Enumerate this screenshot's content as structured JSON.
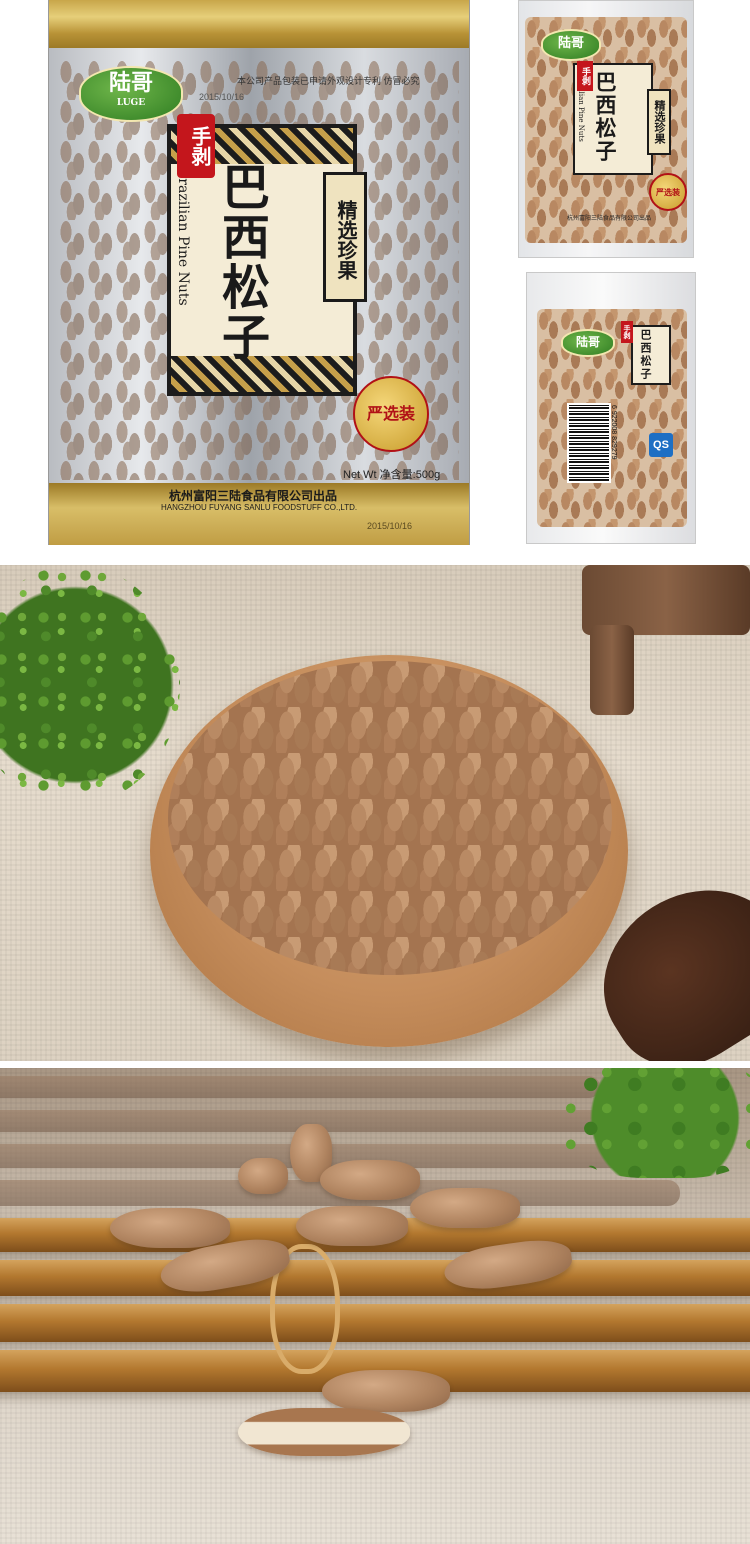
{
  "main_bag": {
    "brand_cn": "陆哥",
    "brand_en": "LUGE",
    "top_notice": "本公司产品包装已申请外观设计专利 仿冒必究",
    "date_top": "2015/10/16",
    "hand_peeled": "手剥",
    "title_cn": "巴西松子",
    "title_en": "Brazilian Pine Nuts",
    "select_label": "精选珍果",
    "seal_text": "严选装",
    "net_weight": "Net Wt 净含量:500g",
    "maker_cn": "杭州富阳三陆食品有限公司出品",
    "maker_en": "HANGZHOU FUYANG SANLU FOODSTUFF CO.,LTD.",
    "date_bottom": "2015/10/16"
  },
  "small_bag_1": {
    "brand_cn": "陆哥",
    "hand_peeled": "手剥",
    "title_cn": "巴西松子",
    "title_en": "Brazilian Pine Nuts",
    "select_label": "精选珍果",
    "seal_text": "严选装",
    "maker_cn": "杭州富阳三陆食品有限公司出品"
  },
  "small_bag_2": {
    "brand_cn": "陆哥",
    "hand_peeled": "手剥",
    "title_cn": "巴西松子",
    "barcode_number": "6 922008 829279",
    "qs_label": "QS"
  }
}
